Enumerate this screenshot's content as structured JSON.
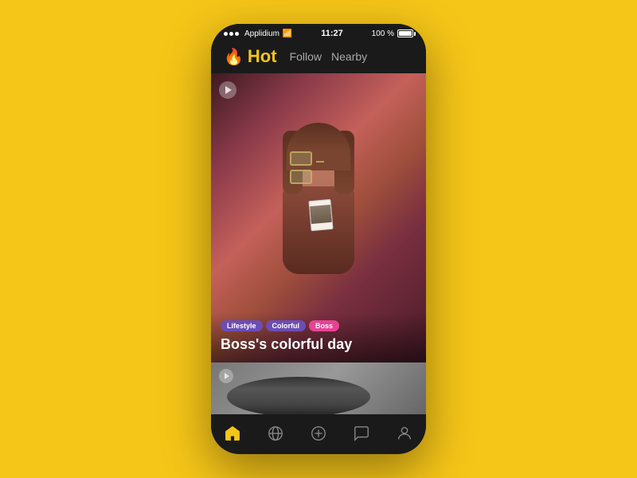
{
  "device": {
    "status_bar": {
      "carrier": "Applidium",
      "wifi_icon": "wifi-icon",
      "time": "11:27",
      "battery_pct": "100 %"
    }
  },
  "header": {
    "app_name": "Hot",
    "flame_glyph": "🔥",
    "tabs": [
      {
        "id": "follow",
        "label": "Follow",
        "active": false
      },
      {
        "id": "nearby",
        "label": "Nearby",
        "active": false
      }
    ]
  },
  "main_card": {
    "play_label": "▶",
    "tags": [
      {
        "label": "Lifestyle",
        "color": "#6c4db5"
      },
      {
        "label": "Colorful",
        "color": "#6c4db5"
      },
      {
        "label": "Boss",
        "color": "#e84393"
      }
    ],
    "title": "Boss's colorful day"
  },
  "second_card": {
    "play_label": "▶"
  },
  "bottom_nav": {
    "items": [
      {
        "id": "home",
        "label": "home",
        "active": true
      },
      {
        "id": "explore",
        "label": "explore",
        "active": false
      },
      {
        "id": "add",
        "label": "add",
        "active": false
      },
      {
        "id": "chat",
        "label": "chat",
        "active": false
      },
      {
        "id": "profile",
        "label": "profile",
        "active": false
      }
    ]
  },
  "colors": {
    "accent": "#F5C518",
    "bg": "#F5C518",
    "inactive_nav": "#888888",
    "tag_lifestyle": "#6c4db5",
    "tag_colorful": "#6c4db5",
    "tag_boss": "#e84393"
  }
}
